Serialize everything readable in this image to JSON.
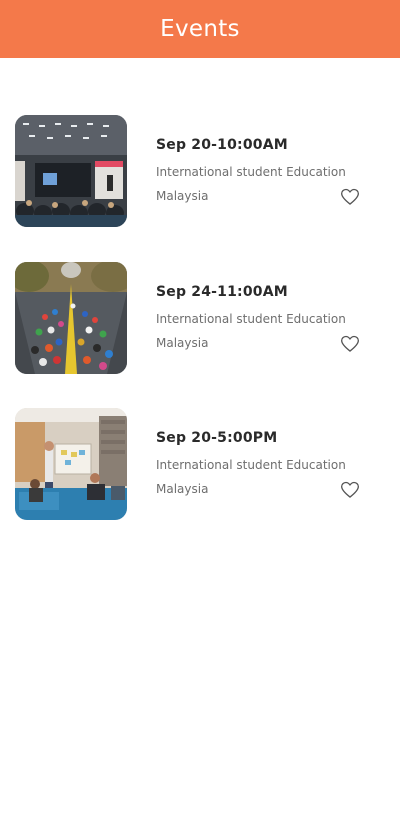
{
  "header": {
    "title": "Events",
    "background_color": "#F4794A"
  },
  "events": [
    {
      "date": "Sep 20-10:00AM",
      "title": "International student Education",
      "location": "Malaysia",
      "image": "conference-hall-photo",
      "favorite_icon": "heart-outline-icon"
    },
    {
      "date": "Sep 24-11:00AM",
      "title": "International student Education",
      "location": "Malaysia",
      "image": "marathon-runners-photo",
      "favorite_icon": "heart-outline-icon"
    },
    {
      "date": "Sep 20-5:00PM",
      "title": "International student Education",
      "location": "Malaysia",
      "image": "office-meeting-photo",
      "favorite_icon": "heart-outline-icon"
    }
  ]
}
